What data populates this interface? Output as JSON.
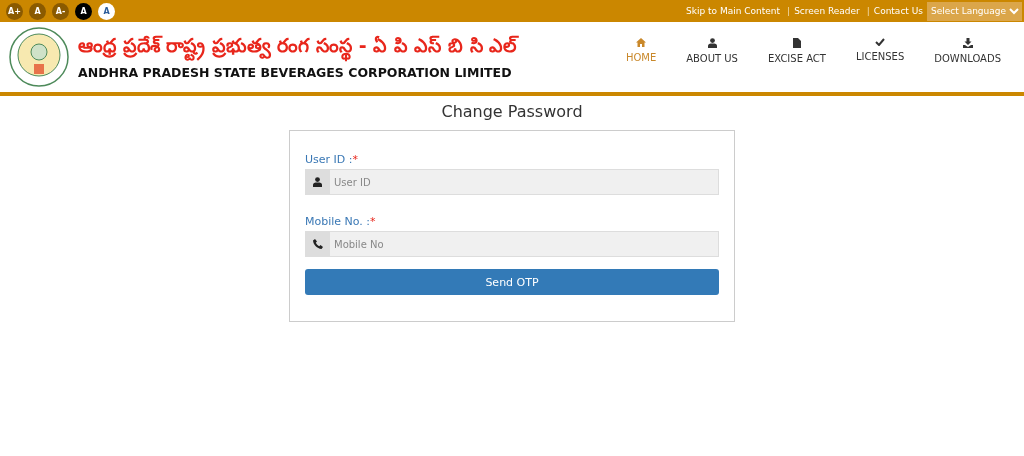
{
  "top_bar": {
    "font_buttons": [
      {
        "label": "A+",
        "kind": "brown"
      },
      {
        "label": "A",
        "kind": "brown"
      },
      {
        "label": "A-",
        "kind": "brown"
      },
      {
        "label": "A",
        "kind": "black"
      },
      {
        "label": "A",
        "kind": "white"
      }
    ],
    "links": [
      {
        "kind": "link",
        "text": "Skip to Main Content"
      },
      {
        "kind": "separator",
        "text": "|"
      },
      {
        "kind": "link",
        "text": "Screen Reader"
      },
      {
        "kind": "separator",
        "text": "|"
      },
      {
        "kind": "link",
        "text": "Contact Us"
      }
    ],
    "language_select": {
      "value": "Select Language"
    }
  },
  "header": {
    "title_telugu": "ఆంధ్ర ప్రదేశ్ రాష్ట్ర ప్రభుత్వ రంగ సంస్థ - ఏ పి ఎస్ బి సి ఎల్",
    "title": "ANDHRA PRADESH STATE BEVERAGES CORPORATION LIMITED",
    "nav": [
      {
        "label": "HOME",
        "selected": true
      },
      {
        "label": "ABOUT US",
        "selected": false
      },
      {
        "label": "EXCISE ACT",
        "selected": false
      },
      {
        "label": "LICENSES",
        "selected": false
      },
      {
        "label": "DOWNLOADS",
        "selected": false
      }
    ]
  },
  "form": {
    "title": "Change Password",
    "fields": [
      {
        "label": "User ID :",
        "required_mark": "*",
        "placeholder": "User ID"
      },
      {
        "label": "Mobile No. :",
        "required_mark": "*",
        "placeholder": "Mobile No"
      }
    ],
    "button": "Send OTP"
  }
}
